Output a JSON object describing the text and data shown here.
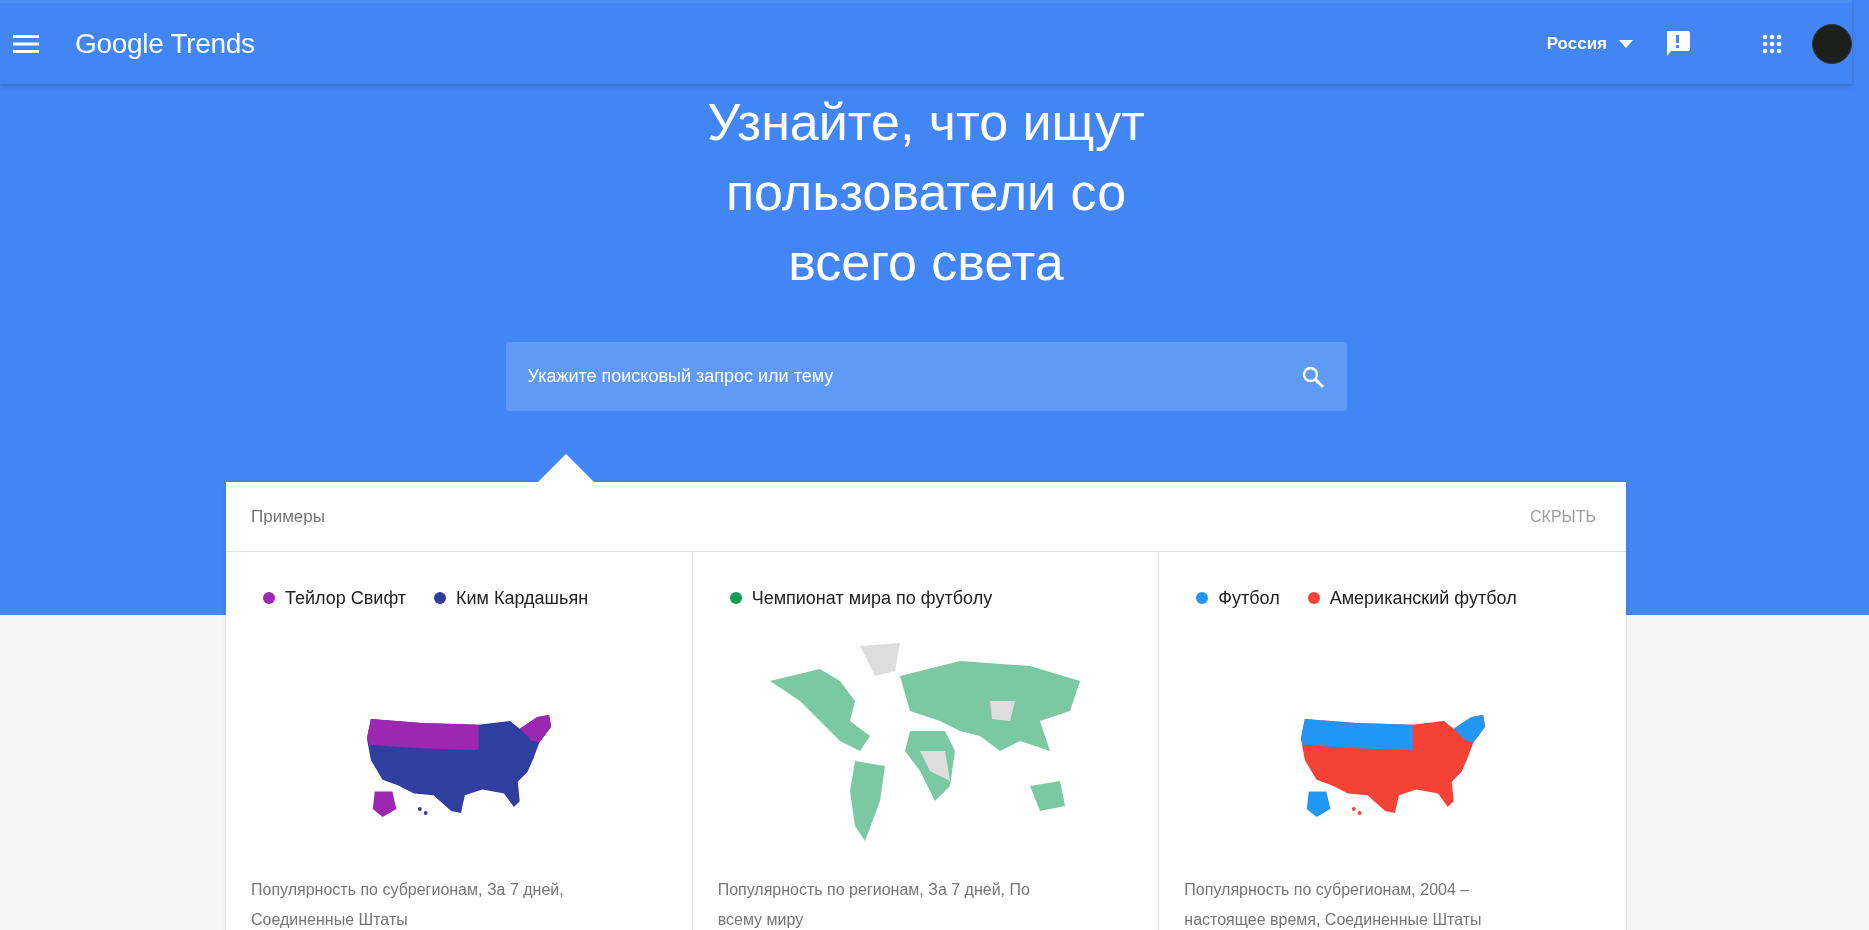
{
  "header": {
    "logo": "Google Trends",
    "region": "Россия"
  },
  "hero": {
    "title": "Узнайте, что ищут пользователи со всего света",
    "search": {
      "placeholder": "Укажите поисковый запрос или тему"
    }
  },
  "examples": {
    "title": "Примеры",
    "hide_button": "СКРЫТЬ",
    "cards": [
      {
        "kind": "us",
        "terms": [
          {
            "label": "Тейлор Свифт",
            "color": "#9c27b0"
          },
          {
            "label": "Ким Кардашьян",
            "color": "#303f9f"
          }
        ],
        "caption": "Популярность по субрегионам, За 7 дней, Соединенные Штаты"
      },
      {
        "kind": "world",
        "terms": [
          {
            "label": "Чемпионат мира по футболу",
            "color": "#0f9d58"
          }
        ],
        "caption": "Популярность по регионам, За 7 дней, По всему миру"
      },
      {
        "kind": "us",
        "terms": [
          {
            "label": "Футбол",
            "color": "#2196f3"
          },
          {
            "label": "Американский футбол",
            "color": "#f44336"
          }
        ],
        "caption": "Популярность по субрегионам, 2004 – настоящее время, Соединенные Штаты"
      }
    ]
  }
}
